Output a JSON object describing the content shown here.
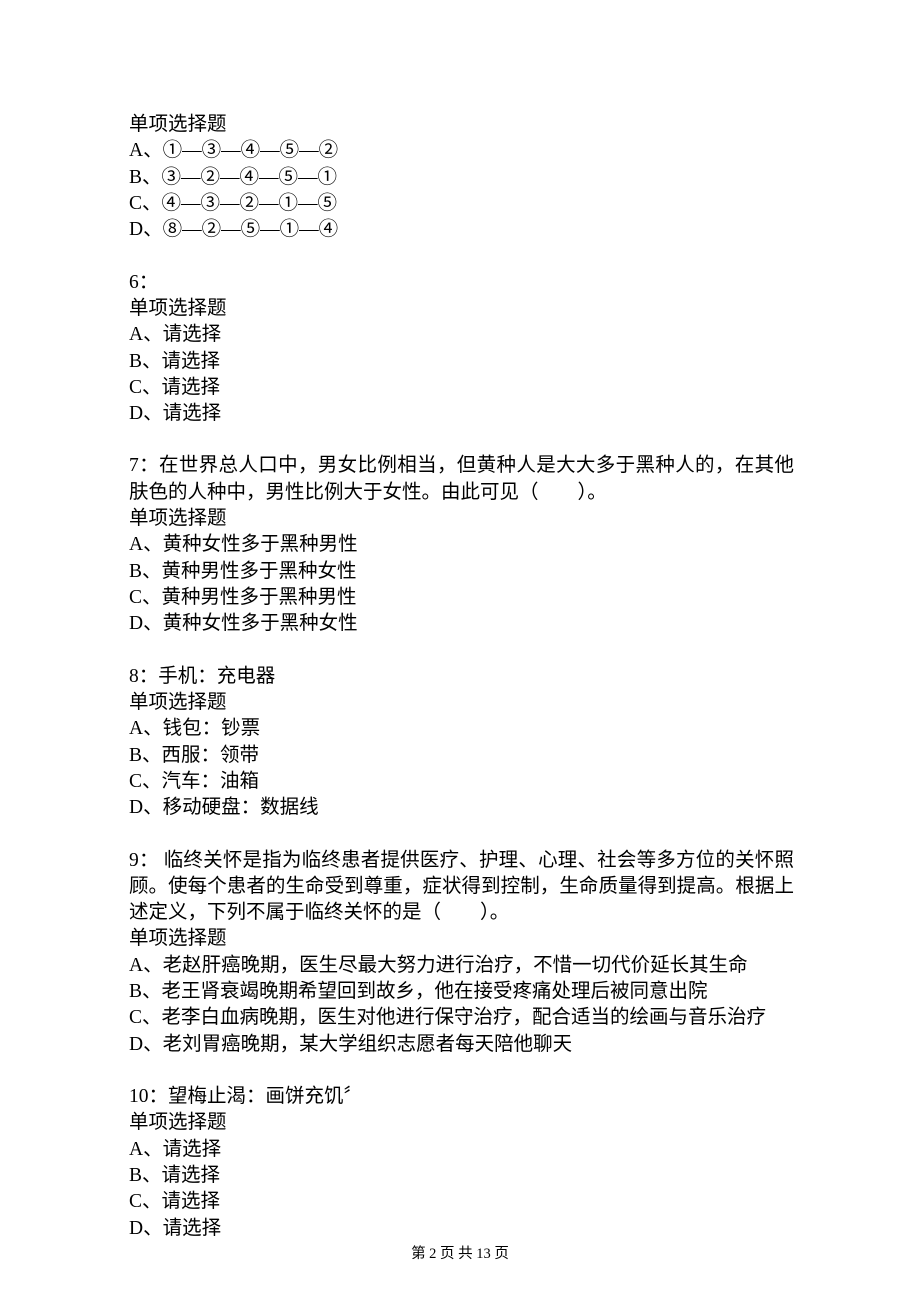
{
  "q5_partial": {
    "type_label": "单项选择题",
    "opts": {
      "A": "A、①—③—④—⑤—②",
      "B": "B、③—②—④—⑤—①",
      "C": "C、④—③—②—①—⑤",
      "D": "D、⑧—②—⑤—①—④"
    }
  },
  "q6": {
    "num": "6：",
    "type_label": "单项选择题",
    "opts": {
      "A": "A、请选择",
      "B": "B、请选择",
      "C": "C、请选择",
      "D": "D、请选择"
    }
  },
  "q7": {
    "stem": "7：在世界总人口中，男女比例相当，但黄种人是大大多于黑种人的，在其他肤色的人种中，男性比例大于女性。由此可见（　　）。",
    "type_label": "单项选择题",
    "opts": {
      "A": "A、黄种女性多于黑种男性",
      "B": "B、黄种男性多于黑种女性",
      "C": "C、黄种男性多于黑种男性",
      "D": "D、黄种女性多于黑种女性"
    }
  },
  "q8": {
    "stem": "8：手机：充电器",
    "type_label": "单项选择题",
    "opts": {
      "A": "A、钱包：钞票",
      "B": "B、西服：领带",
      "C": "C、汽车：油箱",
      "D": "D、移动硬盘：数据线"
    }
  },
  "q9": {
    "stem": "9： 临终关怀是指为临终患者提供医疗、护理、心理、社会等多方位的关怀照顾。使每个患者的生命受到尊重，症状得到控制，生命质量得到提高。根据上述定义，下列不属于临终关怀的是（　　）。",
    "type_label": "单项选择题",
    "opts": {
      "A": "A、老赵肝癌晚期，医生尽最大努力进行治疗，不惜一切代价延长其生命",
      "B": "B、老王肾衰竭晚期希望回到故乡，他在接受疼痛处理后被同意出院",
      "C": "C、老李白血病晚期，医生对他进行保守治疗，配合适当的绘画与音乐治疗",
      "D": "D、老刘胃癌晚期，某大学组织志愿者每天陪他聊天"
    }
  },
  "q10": {
    "stem": "10：望梅止渴：画饼充饥〞",
    "type_label": "单项选择题",
    "opts": {
      "A": "A、请选择",
      "B": "B、请选择",
      "C": "C、请选择",
      "D": "D、请选择"
    }
  },
  "footer": "第 2 页 共 13 页"
}
